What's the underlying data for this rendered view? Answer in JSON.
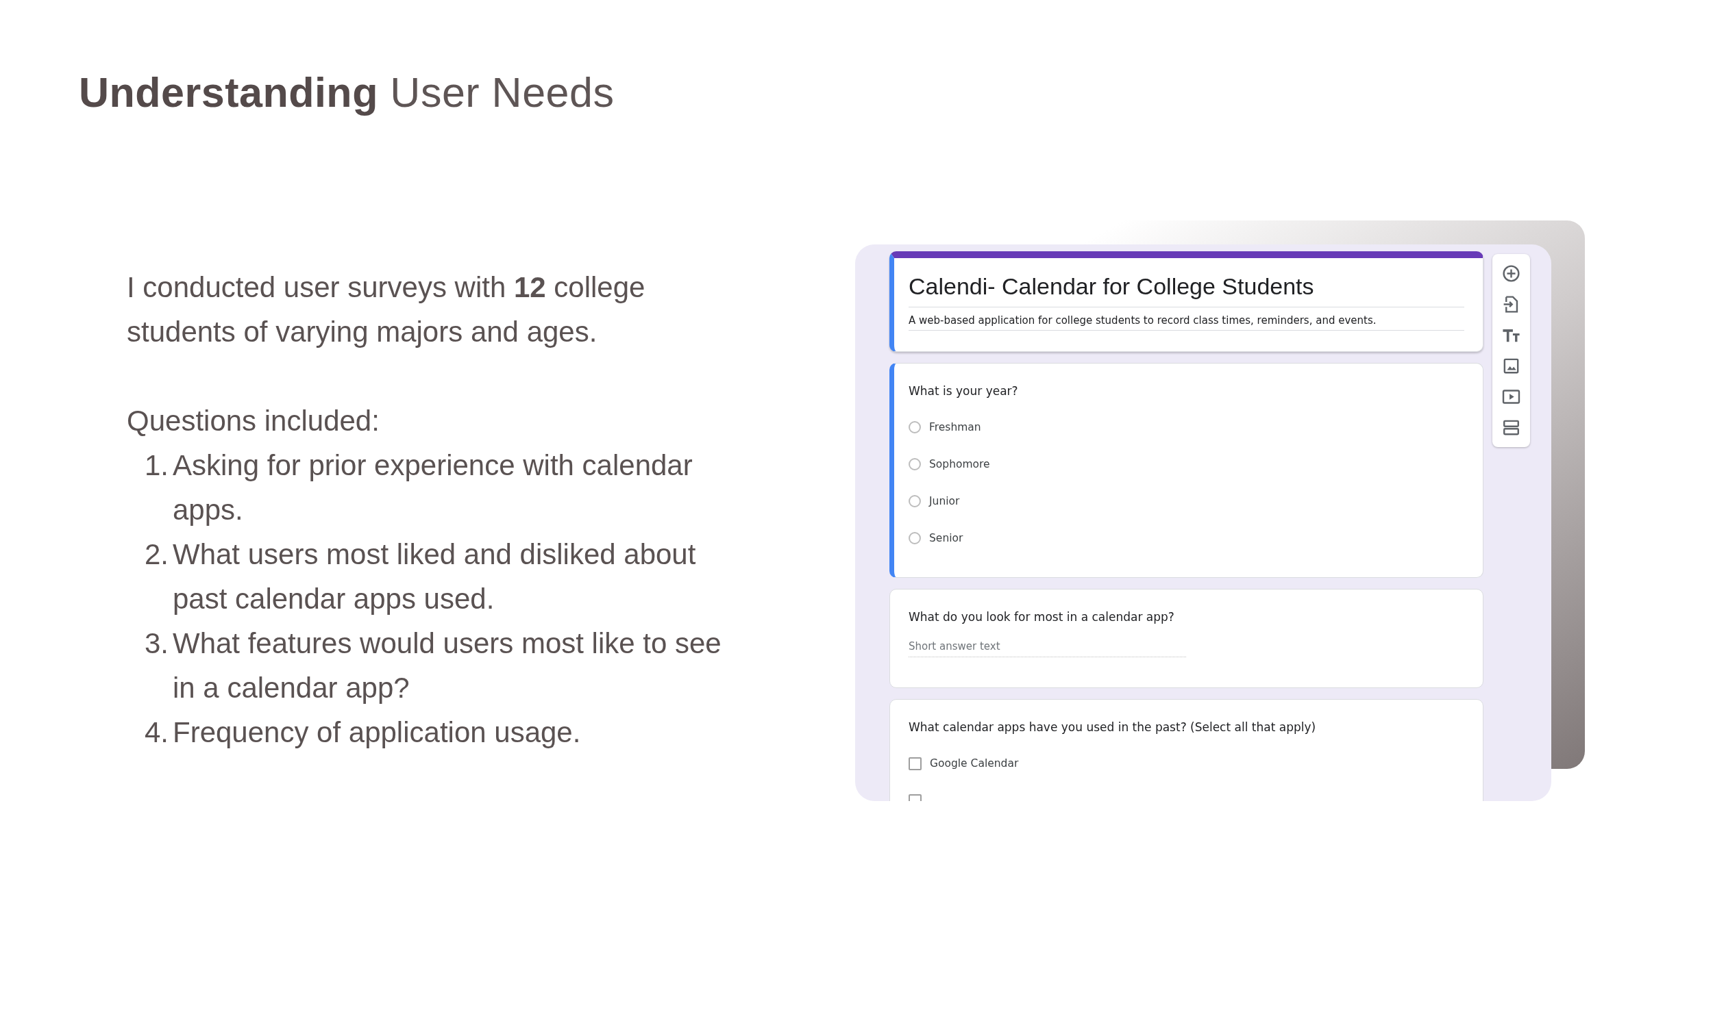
{
  "heading": "**Understanding** User Needs",
  "intro": "I conducted user surveys with **12** college students of varying majors and ages.",
  "questions_label": "Questions included:",
  "questions": [
    {
      "number": "1.",
      "text": "Asking for prior experience with calendar apps."
    },
    {
      "number": "2.",
      "text": "What users most liked and disliked about past calendar apps used."
    },
    {
      "number": "3.",
      "text": "What features would users most like to see in a calendar app?"
    },
    {
      "number": "4.",
      "text": "Frequency of application usage."
    }
  ],
  "form": {
    "title": "Calendi- Calendar for College Students",
    "description": "A web-based application for college students to record class times, reminders, and events.",
    "questions": [
      {
        "kind": "radio",
        "text": "What is your year?",
        "options": [
          {
            "label": "Freshman",
            "selected": false
          },
          {
            "label": "Sophomore",
            "selected": false
          },
          {
            "label": "Junior",
            "selected": false
          },
          {
            "label": "Senior",
            "selected": false
          }
        ]
      },
      {
        "kind": "short",
        "text": "What do you look for most in a calendar app?",
        "placeholder": "Short answer text"
      },
      {
        "kind": "checkbox",
        "text": "What calendar apps have you used in the past? (Select all that apply)",
        "options": [
          {
            "label": "Google Calendar",
            "checked": false
          },
          {
            "checked": false
          }
        ]
      }
    ]
  }
}
